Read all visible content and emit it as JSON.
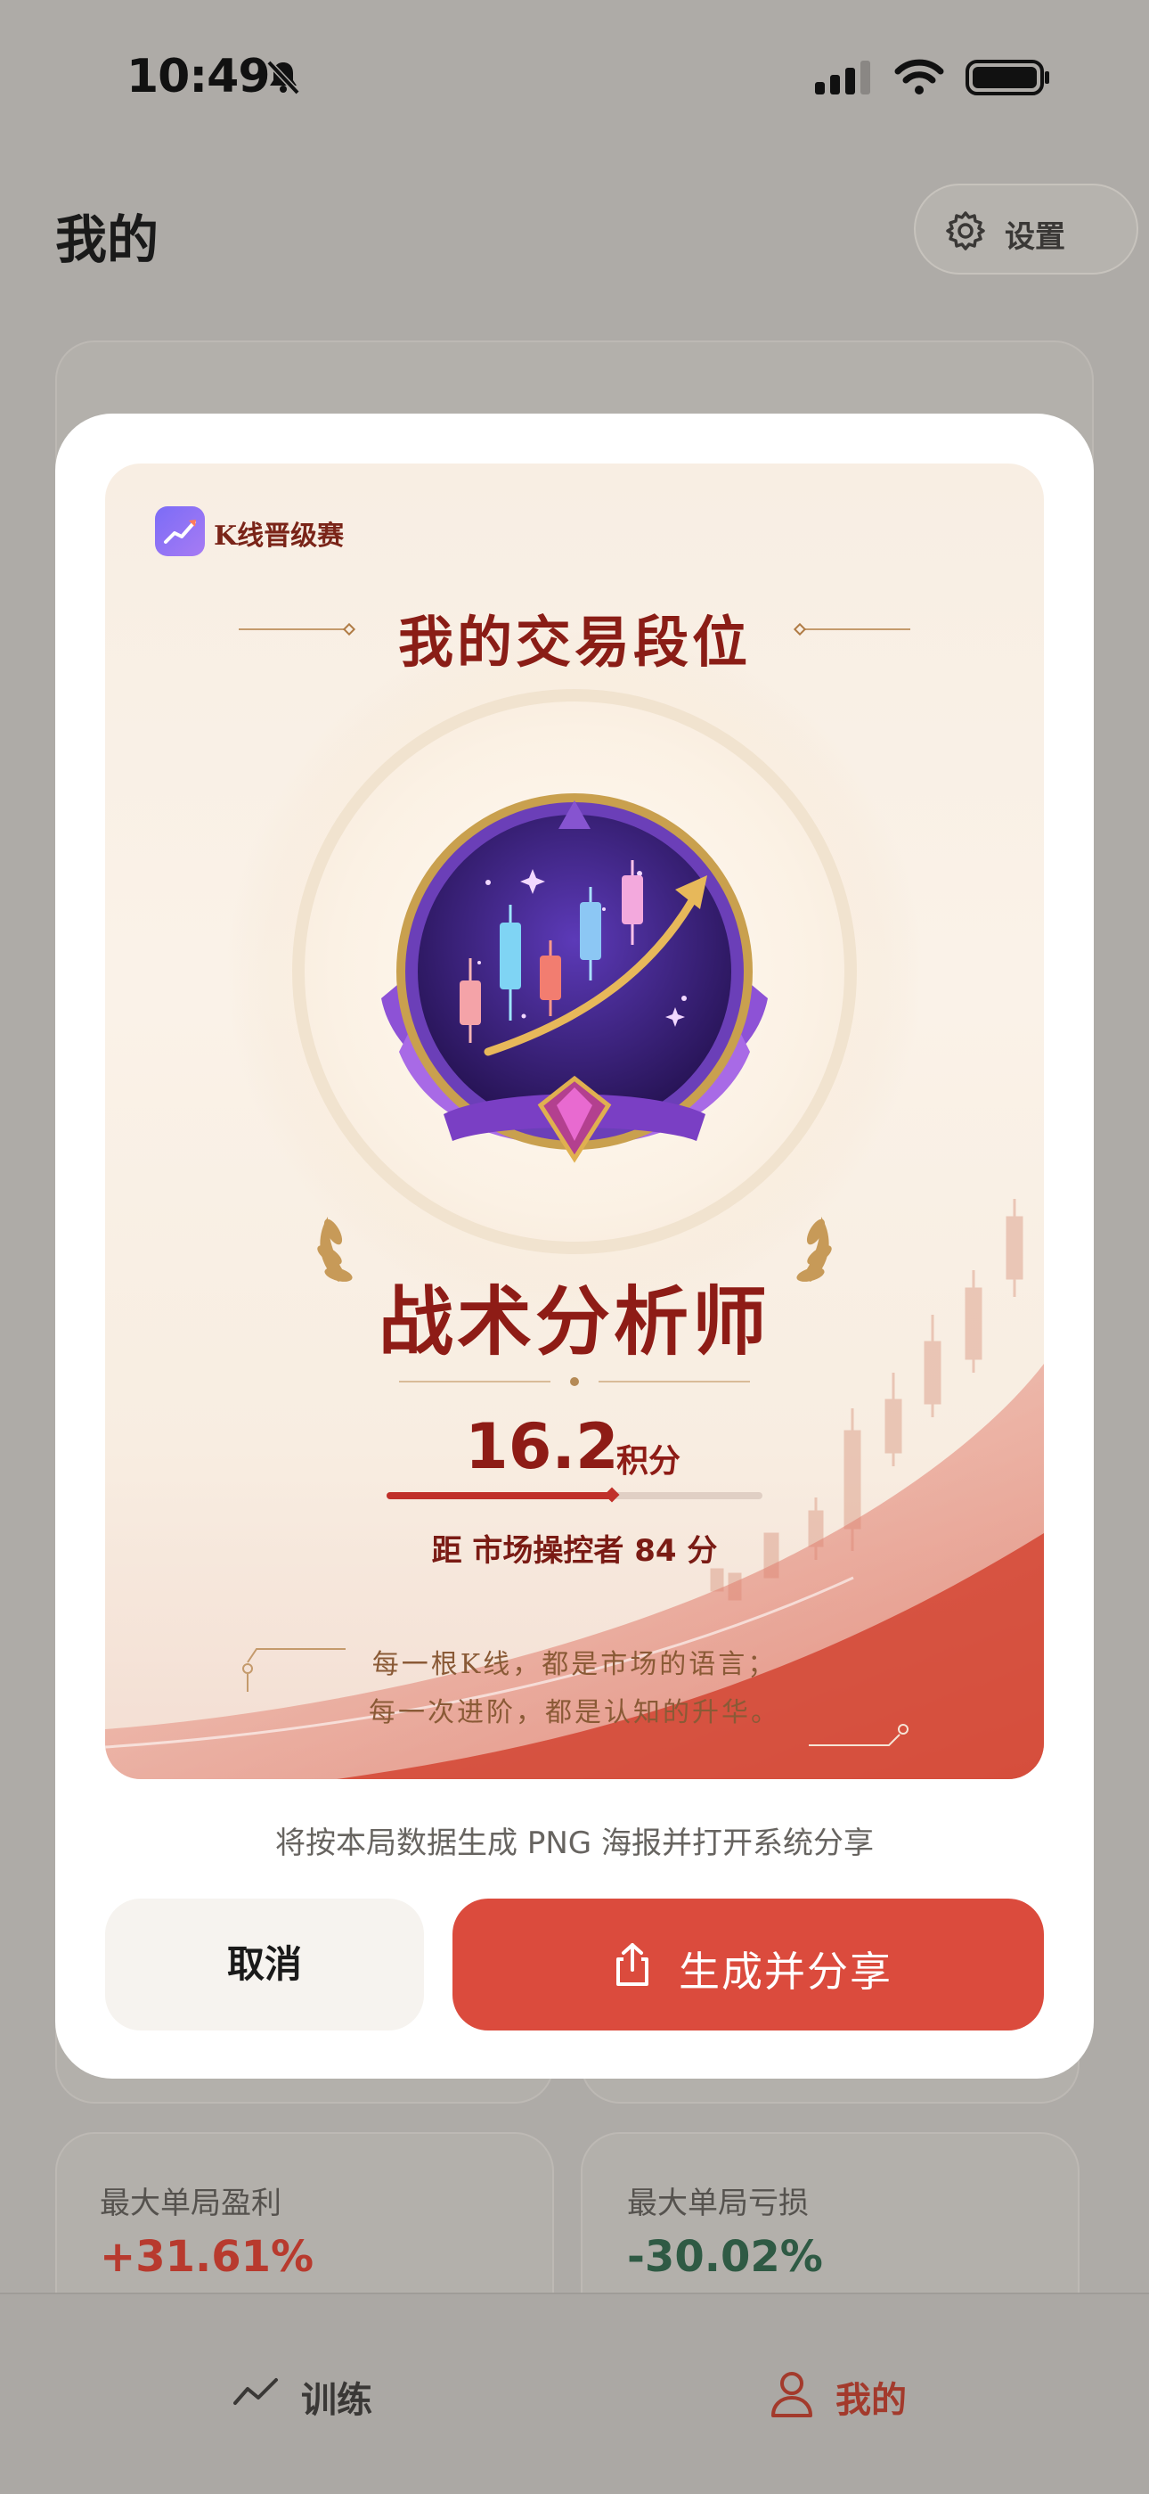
{
  "status": {
    "time": "10:49"
  },
  "header": {
    "title": "我的",
    "settings_label": "设置"
  },
  "stats": {
    "max_profit_label": "最大单局盈利",
    "max_profit_value": "+31.61%",
    "max_loss_label": "最大单局亏损",
    "max_loss_value": "-30.02%"
  },
  "tabbar": {
    "train_label": "训练",
    "mine_label": "我的"
  },
  "modal": {
    "poster": {
      "brand": "K线晋级赛",
      "title": "我的交易段位",
      "rank_name": "战术分析师",
      "score": "16.2",
      "score_unit": "积分",
      "progress": 0.6,
      "next_rank_text": "距 市场操控者 84 分",
      "quote_line1": "每一根K线，都是市场的语言；",
      "quote_line2": "每一次进阶，都是认知的升华。"
    },
    "hint": "将按本局数据生成 PNG 海报并打开系统分享",
    "cancel_label": "取消",
    "share_label": "生成并分享"
  },
  "colors": {
    "accent": "#db4b3d",
    "rank_text": "#8e1c16",
    "profit": "#b83a2e",
    "loss": "#2f5a44"
  }
}
